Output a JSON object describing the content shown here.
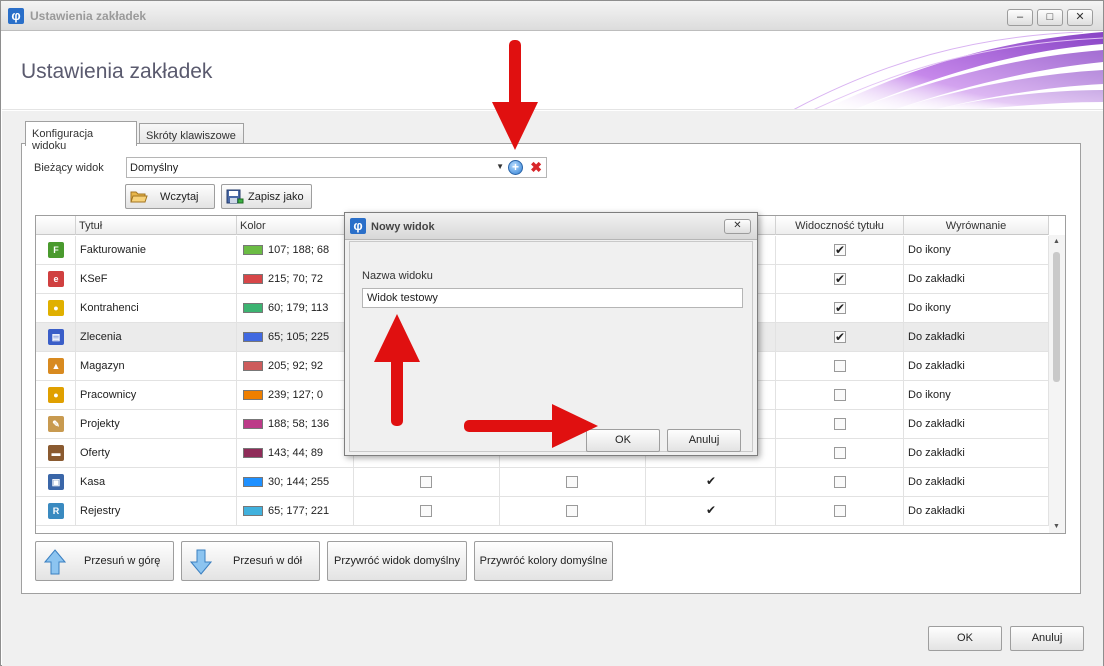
{
  "window": {
    "title": "Ustawienia zakładek",
    "app_icon": "φ",
    "header_title": "Ustawienia zakładek",
    "buttons": {
      "minimize": "–",
      "maximize": "□",
      "close": "✕"
    }
  },
  "tabs": [
    {
      "label": "Konfiguracja widoku",
      "active": true
    },
    {
      "label": "Skróty klawiszowe",
      "active": false
    }
  ],
  "current_view": {
    "label": "Bieżący widok",
    "value": "Domyślny",
    "add_icon": "plus-circle-icon",
    "delete_icon": "red-x-icon"
  },
  "view_buttons": {
    "load": "Wczytaj",
    "save_as": "Zapisz jako"
  },
  "grid": {
    "columns": [
      "Tytuł",
      "Kolor",
      "Widoczność tytułu",
      "Wyrównanie"
    ],
    "rows": [
      {
        "title": "Fakturowanie",
        "color": "#6bbc44",
        "color_text": "107; 188; 68",
        "icon_color": "#4a9a2e",
        "icon_letter": "F",
        "c3": null,
        "c4": null,
        "c5": null,
        "title_visible": true,
        "align": "Do ikony"
      },
      {
        "title": "KSeF",
        "color": "#d74648",
        "color_text": "215; 70; 72",
        "icon_color": "#d04040",
        "icon_letter": "e",
        "c3": null,
        "c4": null,
        "c5": null,
        "title_visible": true,
        "align": "Do zakładki"
      },
      {
        "title": "Kontrahenci",
        "color": "#3cb371",
        "color_text": "60; 179; 113",
        "icon_color": "#e0b000",
        "icon_letter": "●",
        "c3": null,
        "c4": null,
        "c5": null,
        "title_visible": true,
        "align": "Do ikony"
      },
      {
        "title": "Zlecenia",
        "color": "#4169e1",
        "color_text": "65; 105; 225",
        "icon_color": "#3a5ec8",
        "icon_letter": "▤",
        "c3": null,
        "c4": null,
        "c5": null,
        "title_visible": true,
        "align": "Do zakładki",
        "selected": true
      },
      {
        "title": "Magazyn",
        "color": "#cd5c5c",
        "color_text": "205; 92; 92",
        "icon_color": "#d88a20",
        "icon_letter": "▲",
        "c3": null,
        "c4": null,
        "c5": null,
        "title_visible": false,
        "align": "Do zakładki"
      },
      {
        "title": "Pracownicy",
        "color": "#ef7f00",
        "color_text": "239; 127; 0",
        "icon_color": "#e0a000",
        "icon_letter": "●",
        "c3": null,
        "c4": null,
        "c5": null,
        "title_visible": false,
        "align": "Do ikony"
      },
      {
        "title": "Projekty",
        "color": "#bc3a88",
        "color_text": "188; 58; 136",
        "icon_color": "#c89a50",
        "icon_letter": "✎",
        "c3": null,
        "c4": null,
        "c5": null,
        "title_visible": false,
        "align": "Do zakładki"
      },
      {
        "title": "Oferty",
        "color": "#8f2c59",
        "color_text": "143; 44; 89",
        "icon_color": "#8a5a30",
        "icon_letter": "▬",
        "c3": null,
        "c4": null,
        "c5": null,
        "title_visible": false,
        "align": "Do zakładki"
      },
      {
        "title": "Kasa",
        "color": "#1e90ff",
        "color_text": "30; 144; 255",
        "icon_color": "#3a66a8",
        "icon_letter": "▣",
        "c3": false,
        "c4": false,
        "c5": true,
        "title_visible": false,
        "align": "Do zakładki"
      },
      {
        "title": "Rejestry",
        "color": "#41b1dd",
        "color_text": "65; 177; 221",
        "icon_color": "#3a8ac0",
        "icon_letter": "R",
        "c3": false,
        "c4": false,
        "c5": true,
        "title_visible": false,
        "align": "Do zakładki"
      }
    ]
  },
  "bottom_buttons": {
    "move_up": "Przesuń w górę",
    "move_down": "Przesuń w dół",
    "restore_view": "Przywróć widok domyślny",
    "restore_colors": "Przywróć kolory domyślne"
  },
  "footer": {
    "ok": "OK",
    "cancel": "Anuluj"
  },
  "dialog": {
    "title": "Nowy widok",
    "field_label": "Nazwa widoku",
    "field_value": "Widok testowy",
    "ok": "OK",
    "cancel": "Anuluj",
    "close": "✕"
  },
  "colors": {
    "accent_arrow": "#e01010",
    "header_swoosh": "#9b3fd0"
  }
}
